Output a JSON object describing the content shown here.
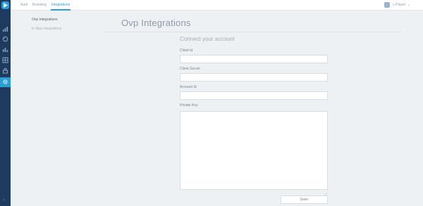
{
  "app": {
    "accent_color": "#2a9fd6",
    "sidebar_color": "#1f3a5f"
  },
  "sidebar": {
    "icons": [
      "logo-icon",
      "bar-chart-icon",
      "palette-icon",
      "stats-icon",
      "grid-icon",
      "lock-icon",
      "gear-icon",
      "expand-arrow-icon"
    ],
    "expand_glyph": "›"
  },
  "header": {
    "tabs": [
      {
        "label": "Audi",
        "active": false
      },
      {
        "label": "Branding",
        "active": false
      },
      {
        "label": "Integrations",
        "active": true
      }
    ],
    "player_name": "c-Player",
    "player_chevron": "⌄"
  },
  "subnav": {
    "items": [
      {
        "label": "Ovp Integrations",
        "active": true
      },
      {
        "label": "In-App Integrations",
        "active": false
      }
    ]
  },
  "main": {
    "title": "Ovp Integrations",
    "section_title": "Connect your account",
    "fields": [
      {
        "label": "Client Id",
        "value": ""
      },
      {
        "label": "Client Secret",
        "value": ""
      },
      {
        "label": "Account Id",
        "value": ""
      },
      {
        "label": "Private Key",
        "value": ""
      }
    ],
    "save_label": "Save"
  }
}
